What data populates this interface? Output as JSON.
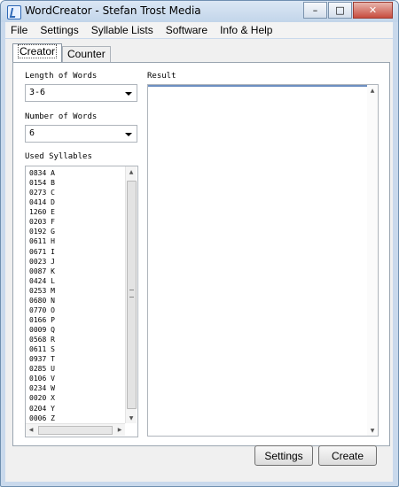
{
  "window": {
    "title": "WordCreator - Stefan Trost Media",
    "controls": {
      "minimize": "–",
      "maximize": "□",
      "close": "✕"
    }
  },
  "menu": [
    "File",
    "Settings",
    "Syllable Lists",
    "Software",
    "Info & Help"
  ],
  "tabs": [
    "Creator",
    "Counter"
  ],
  "creator": {
    "length_label": "Length of Words",
    "length_value": "3-6",
    "number_label": "Number of Words",
    "number_value": "6",
    "syllables_label": "Used Syllables",
    "syllables": [
      "0834  A",
      "0154  B",
      "0273  C",
      "0414  D",
      "1260  E",
      "0203  F",
      "0192  G",
      "0611  H",
      "0671  I",
      "0023  J",
      "0087  K",
      "0424  L",
      "0253  M",
      "0680  N",
      "0770  O",
      "0166  P",
      "0009  Q",
      "0568  R",
      "0611  S",
      "0937  T",
      "0285  U",
      "0106  V",
      "0234  W",
      "0020  X",
      "0204  Y",
      "0006  Z"
    ],
    "result_label": "Result",
    "result_text": ""
  },
  "buttons": {
    "settings": "Settings",
    "create": "Create"
  },
  "icons": {
    "app": "wordcreator-app-icon",
    "chevron": "chevron-down-icon",
    "scroll_up": "scroll-up-arrow-icon",
    "scroll_down": "scroll-down-arrow-icon",
    "scroll_left": "scroll-left-arrow-icon",
    "scroll_right": "scroll-right-arrow-icon"
  },
  "colors": {
    "title_bar": "#c9d9ec",
    "result_focus": "#6d8fc1",
    "close_button": "#c74d3f"
  }
}
